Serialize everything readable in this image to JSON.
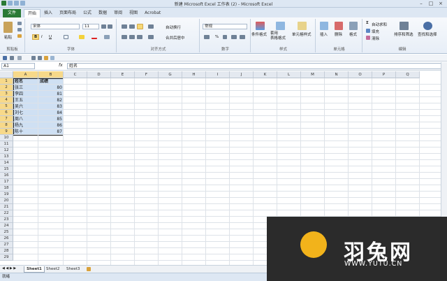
{
  "window": {
    "title": "新建 Microsoft Excel 工作表 (2) - Microsoft Excel"
  },
  "tabs": {
    "file": "文件",
    "items": [
      "开始",
      "插入",
      "页面布局",
      "公式",
      "数据",
      "审阅",
      "视图",
      "Acrobat"
    ],
    "active": "开始"
  },
  "ribbon": {
    "clipboard": {
      "label": "剪贴板",
      "paste": "粘贴"
    },
    "font": {
      "label": "字体",
      "font_name": "宋体",
      "font_size": "11",
      "bold": "B",
      "italic": "I",
      "underline": "U"
    },
    "alignment": {
      "label": "对齐方式",
      "wrap": "自动换行",
      "merge": "合并后居中"
    },
    "number": {
      "label": "数字",
      "format": "常规",
      "percent": "%"
    },
    "styles": {
      "label": "样式",
      "cond_format": "条件格式",
      "table_format": "套用\n表格格式",
      "cell_styles": "单元格样式"
    },
    "cells": {
      "label": "单元格",
      "insert": "插入",
      "delete": "删除",
      "format": "格式"
    },
    "editing": {
      "label": "编辑",
      "autosum": "自动求和",
      "fill": "填充",
      "clear": "清除",
      "sort_filter": "排序和筛选",
      "find_select": "查找和选择"
    }
  },
  "formula_bar": {
    "name_box": "A1",
    "fx": "fx",
    "content": "姓名"
  },
  "columns": [
    "A",
    "B",
    "C",
    "D",
    "E",
    "F",
    "G",
    "H",
    "I",
    "J",
    "K",
    "L",
    "M",
    "N",
    "O",
    "P",
    "Q"
  ],
  "rows": [
    "1",
    "2",
    "3",
    "4",
    "5",
    "6",
    "7",
    "8",
    "9",
    "10",
    "11",
    "12",
    "13",
    "14",
    "15",
    "16",
    "17",
    "18",
    "19",
    "20",
    "21",
    "22",
    "23",
    "24",
    "25",
    "26",
    "27",
    "28",
    "29"
  ],
  "table": {
    "headers": [
      "姓名",
      "成绩"
    ],
    "rows": [
      [
        "张三",
        "80"
      ],
      [
        "李四",
        "81"
      ],
      [
        "王五",
        "82"
      ],
      [
        "吴六",
        "83"
      ],
      [
        "刘七",
        "84"
      ],
      [
        "周八",
        "85"
      ],
      [
        "杨九",
        "86"
      ],
      [
        "陈十",
        "87"
      ]
    ]
  },
  "sheets": [
    "Sheet1",
    "Sheet2",
    "Sheet3"
  ],
  "active_sheet": "Sheet1",
  "status": {
    "text": "就绪"
  },
  "watermark": {
    "name": "羽兔网",
    "url": "WWW.YUTU.CN"
  }
}
